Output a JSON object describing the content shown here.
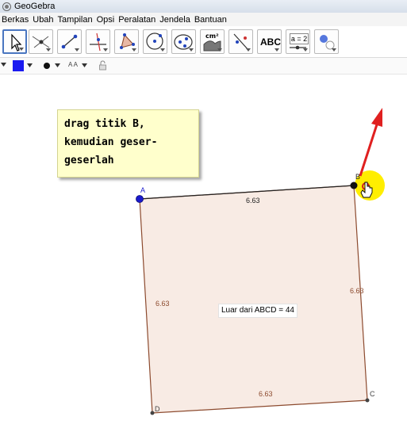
{
  "window": {
    "title": "GeoGebra"
  },
  "menu": [
    "Berkas",
    "Ubah",
    "Tampilan",
    "Opsi",
    "Peralatan",
    "Jendela",
    "Bantuan"
  ],
  "toolbar": {
    "tools": [
      {
        "icon": "move-arrow-icon",
        "active": true
      },
      {
        "icon": "point-icon"
      },
      {
        "icon": "segment-icon"
      },
      {
        "icon": "perpendicular-line-icon"
      },
      {
        "icon": "polygon-icon"
      },
      {
        "icon": "circle-center-point-icon"
      },
      {
        "icon": "conic-ellipse-icon"
      },
      {
        "icon": "measure-area-icon",
        "label": "cm²"
      },
      {
        "icon": "reflect-line-icon"
      },
      {
        "icon": "text-icon",
        "label": "ABC"
      },
      {
        "icon": "slider-icon",
        "label": "a = 2"
      },
      {
        "icon": "show-hide-object-icon"
      }
    ]
  },
  "stylebar": {
    "color": "#1a1af0",
    "font_size_label": "A A"
  },
  "note": {
    "lines": [
      "drag titik B,",
      "kemudian geser-",
      "geserlah"
    ]
  },
  "points": [
    {
      "name": "A"
    },
    {
      "name": "B"
    },
    {
      "name": "C"
    },
    {
      "name": "D"
    }
  ],
  "side_labels": {
    "top": "6.63",
    "right": "6.63",
    "bottom": "6.63",
    "left": "6.63"
  },
  "area_text": "Luar dari ABCD = 44",
  "colors": {
    "polygon_fill": "#f7e9e1",
    "polygon_stroke": "#8c4a2e",
    "point_blue": "#1a1acc",
    "arrow_red": "#e02020",
    "highlight": "#ffee00"
  }
}
